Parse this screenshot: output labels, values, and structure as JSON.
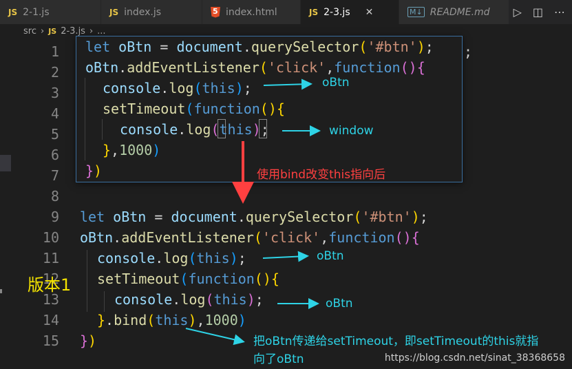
{
  "tabs": [
    {
      "label": "2-1.js",
      "type": "js",
      "active": false
    },
    {
      "label": "index.js",
      "type": "js",
      "active": false
    },
    {
      "label": "index.html",
      "type": "html",
      "active": false
    },
    {
      "label": "2-3.js",
      "type": "js",
      "active": true
    },
    {
      "label": "README.md",
      "type": "md",
      "active": false
    }
  ],
  "tab_close_glyph": "✕",
  "tab_badge_js": "JS",
  "tab_badge_md": "M↓",
  "breadcrumb": {
    "folder": "src",
    "file": "2-3.js",
    "more": "..."
  },
  "line_numbers": [
    "1",
    "2",
    "3",
    "4",
    "5",
    "6",
    "7",
    "8",
    "9",
    "10",
    "11",
    "12",
    "13",
    "14",
    "15"
  ],
  "popup_code": {
    "l1": [
      "let",
      "oBtn",
      "=",
      "document",
      ".",
      "querySelector",
      "(",
      "'#btn'",
      ")",
      ";"
    ],
    "l2": [
      "oBtn",
      ".",
      "addEventListener",
      "(",
      "'click'",
      ",",
      "function",
      "(",
      ")",
      "{"
    ],
    "l3": [
      "console",
      ".",
      "log",
      "(",
      "this",
      ")",
      ";"
    ],
    "l4": [
      "setTimeout",
      "(",
      "function",
      "(",
      ")",
      "{"
    ],
    "l5": [
      "console",
      ".",
      "log",
      "(",
      "this",
      ")",
      ";"
    ],
    "l6": [
      "}",
      ",",
      "1000",
      ")"
    ],
    "l7": [
      "}",
      ")"
    ]
  },
  "main_code": {
    "l9": [
      "let",
      "oBtn",
      "=",
      "document",
      ".",
      "querySelector",
      "(",
      "'#btn'",
      ")",
      ";"
    ],
    "l10": [
      "oBtn",
      ".",
      "addEventListener",
      "(",
      "'click'",
      ",",
      "function",
      "(",
      ")",
      "{"
    ],
    "l11": [
      "console",
      ".",
      "log",
      "(",
      "this",
      ")",
      ";"
    ],
    "l12": [
      "setTimeout",
      "(",
      "function",
      "(",
      ")",
      "{"
    ],
    "l13": [
      "console",
      ".",
      "log",
      "(",
      "this",
      ")",
      ";"
    ],
    "l14": [
      "}",
      ".",
      "bind",
      "(",
      "this",
      ")",
      ",",
      "1000",
      ")"
    ],
    "l15": [
      "}",
      ")"
    ]
  },
  "annotations": {
    "popup_obtn": "oBtn",
    "popup_window": "window",
    "change_note": "使用bind改变this指向后",
    "main_obtn_1": "oBtn",
    "main_obtn_2": "oBtn",
    "version": "版本1",
    "bottom_note_1": "把oBtn传递给setTimeout，即setTimeout的this就指",
    "bottom_note_2": "向了oBtn"
  },
  "watermark": "https://blog.csdn.net/sinat_38368658",
  "colors": {
    "cyan": "#2ed3e6",
    "red": "#ff4040",
    "yellow": "#f4e300",
    "popup_border": "#3b6fa0"
  }
}
